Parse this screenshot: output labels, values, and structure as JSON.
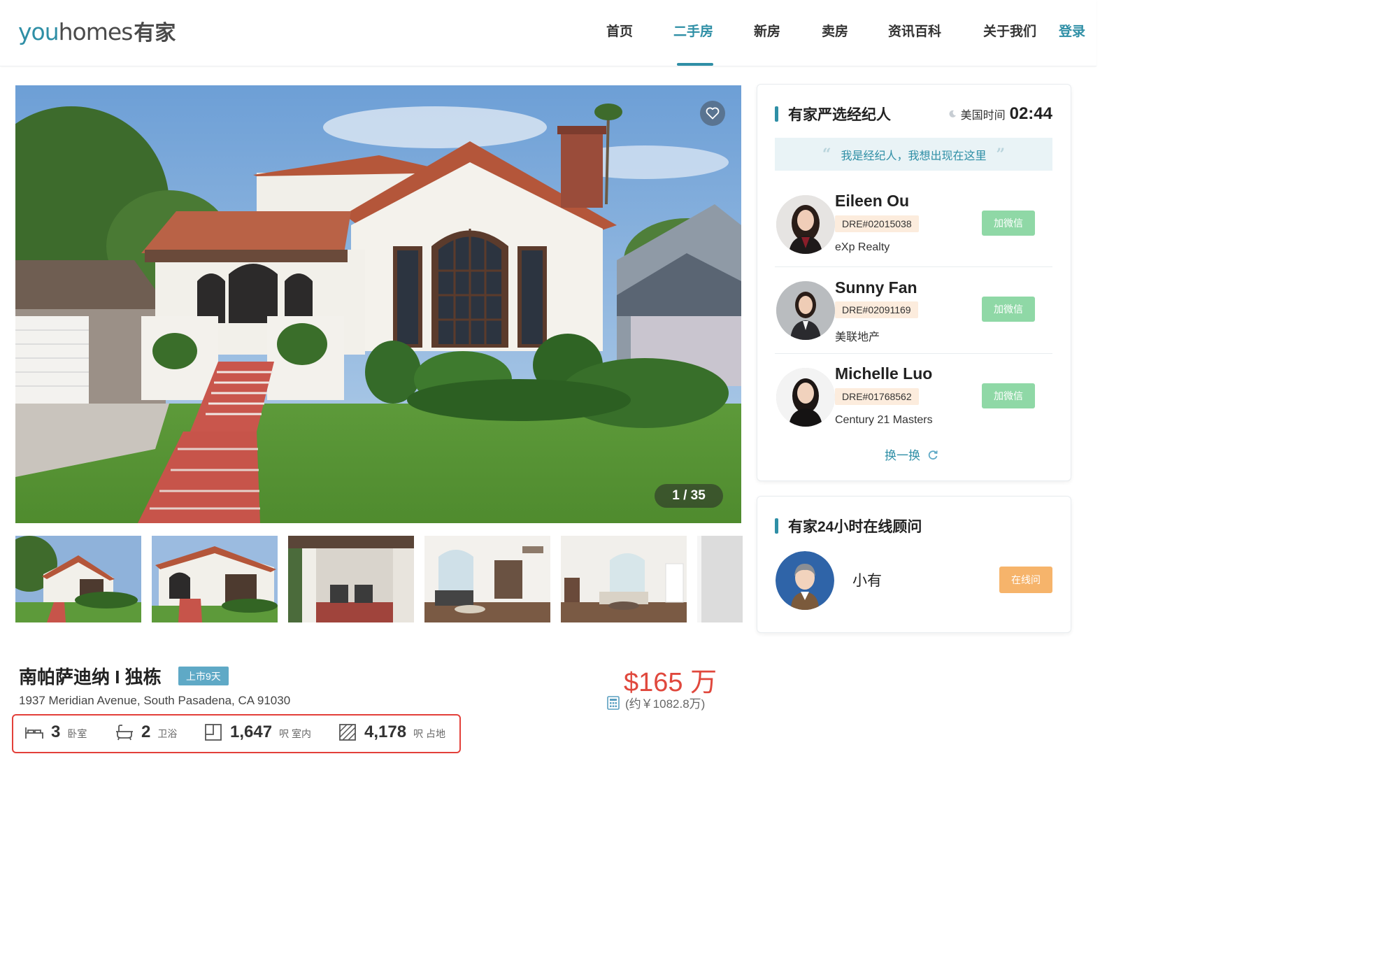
{
  "logo": {
    "text_en_a": "you",
    "text_en_b": "homes",
    "text_zh": "有家"
  },
  "nav": {
    "items": [
      {
        "label": "首页",
        "active": false
      },
      {
        "label": "二手房",
        "active": true
      },
      {
        "label": "新房",
        "active": false
      },
      {
        "label": "卖房",
        "active": false
      },
      {
        "label": "资讯百科",
        "active": false
      },
      {
        "label": "关于我们",
        "active": false
      }
    ],
    "login": "登录"
  },
  "gallery": {
    "counter": "1 / 35",
    "thumbnail_count_visible": 6,
    "favorite_icon": "heart-icon"
  },
  "listing": {
    "title": "南帕萨迪纳 I 独栋",
    "badge": "上市9天",
    "address": "1937 Meridian Avenue, South Pasadena, CA 91030",
    "price": "$165 万",
    "price_cny": "(约￥1082.8万)",
    "stats": [
      {
        "icon": "bed-icon",
        "value": "3",
        "unit": "卧室"
      },
      {
        "icon": "bathtub-icon",
        "value": "2",
        "unit": "卫浴"
      },
      {
        "icon": "floor-area-icon",
        "value": "1,647",
        "unit": "呎 室内"
      },
      {
        "icon": "lot-area-icon",
        "value": "4,178",
        "unit": "呎 占地"
      }
    ]
  },
  "agents_panel": {
    "title": "有家严选经纪人",
    "clock_label": "美国时间",
    "clock_time": "02:44",
    "slogan": "我是经纪人，我想出现在这里",
    "agents": [
      {
        "name": "Eileen Ou",
        "dre": "DRE#02015038",
        "company": "eXp Realty",
        "button": "加微信"
      },
      {
        "name": "Sunny Fan",
        "dre": "DRE#02091169",
        "company": "美联地产",
        "button": "加微信"
      },
      {
        "name": "Michelle Luo",
        "dre": "DRE#01768562",
        "company": "Century 21 Masters",
        "button": "加微信"
      }
    ],
    "refresh": "换一换"
  },
  "advisor_panel": {
    "title": "有家24小时在线顾问",
    "name": "小有",
    "button": "在线问"
  },
  "colors": {
    "brand": "#2f8fa6",
    "price": "#e0483d",
    "wechat": "#8fd8a6",
    "online": "#f6b46b",
    "highlight_border": "#e3403a"
  }
}
